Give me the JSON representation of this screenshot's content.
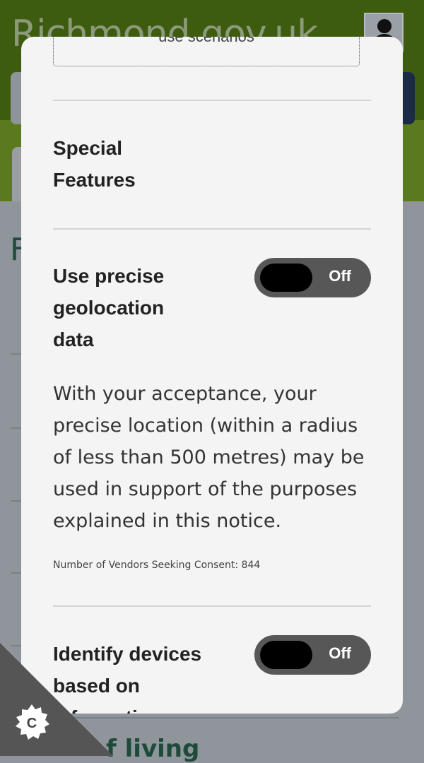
{
  "background_page": {
    "site_title": "Richmond.gov.uk",
    "heading_initial": "F",
    "bottom_text": "f living"
  },
  "modal": {
    "truncated_button_label": "use scenarios",
    "special_features": {
      "heading": "Special Features"
    },
    "geolocation": {
      "title": "Use precise geolocation data",
      "toggle_state": "Off",
      "description": "With your acceptance, your precise location (within a radius of less than 500 metres) may be used in support of the purposes explained in this notice.",
      "vendors_text": "Number of Vendors Seeking Consent: 844"
    },
    "device_scan": {
      "title": "Identify devices based on information",
      "toggle_state": "Off"
    }
  },
  "cookie_settings": {
    "icon_letter": "C",
    "icon": "cookie-gear-icon"
  },
  "colors": {
    "header_dark_green": "#3d5c10",
    "header_green": "#5a7a1d",
    "overlay_gray": "#8f959a",
    "modal_bg": "#f4f4f4",
    "toggle_bg": "#575757"
  }
}
